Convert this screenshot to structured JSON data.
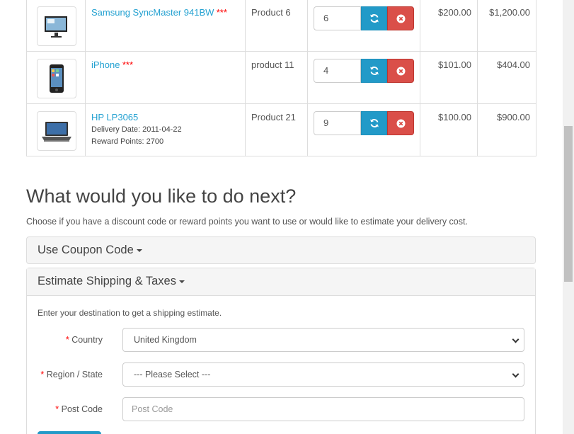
{
  "cart": {
    "rows": [
      {
        "name": "Samsung SyncMaster 941BW",
        "stars": "***",
        "model": "Product 6",
        "quantity": "6",
        "unit_price": "$200.00",
        "total": "$1,200.00",
        "image_icon": "monitor-icon"
      },
      {
        "name": "iPhone",
        "stars": "***",
        "model": "product 11",
        "quantity": "4",
        "unit_price": "$101.00",
        "total": "$404.00",
        "image_icon": "smartphone-icon"
      },
      {
        "name": "HP LP3065",
        "stars": "",
        "delivery_date": "Delivery Date: 2011-04-22",
        "reward_points": "Reward Points: 2700",
        "model": "Product 21",
        "quantity": "9",
        "unit_price": "$100.00",
        "total": "$900.00",
        "image_icon": "laptop-icon"
      }
    ],
    "update_icon": "refresh-icon",
    "remove_icon": "remove-icon"
  },
  "next": {
    "title": "What would you like to do next?",
    "intro": "Choose if you have a discount code or reward points you want to use or would like to estimate your delivery cost."
  },
  "coupon": {
    "title": "Use Coupon Code"
  },
  "shipping": {
    "title": "Estimate Shipping & Taxes",
    "intro": "Enter your destination to get a shipping estimate.",
    "country_label": "Country",
    "country_value": "United Kingdom",
    "region_label": "Region / State",
    "region_value": " --- Please Select --- ",
    "postcode_label": "Post Code",
    "postcode_placeholder": "Post Code",
    "required_mark": "*"
  },
  "colors": {
    "link": "#23a1d1",
    "primary": "#229ac8",
    "danger": "#da4f49",
    "required": "#ff0000"
  }
}
